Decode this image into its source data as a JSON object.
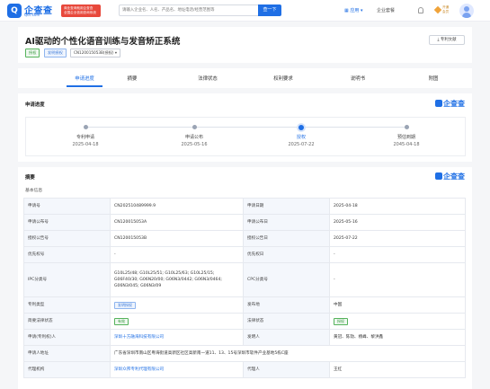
{
  "header": {
    "logo_letter": "Q",
    "logo_text": "企查查",
    "logo_sub": "Qcc.com",
    "promo_line1": "商业查询就用企查查",
    "promo_line2": "全国企业信用查询系统",
    "search_placeholder": "请输入企业名、人名、产品名、地址电话/经营范围等",
    "search_button": "查一下",
    "app_label": "应用",
    "enterprise_edition": "企业套餐",
    "vip_line1": "开通",
    "vip_line2": "会员"
  },
  "title_section": {
    "title": "AI驱动的个性化语音训练与发音矫正系统",
    "tags": [
      "授权",
      "发明授权"
    ],
    "patent_number_tag": "CN120015053B(授权)",
    "patent_file_button": "专利文献"
  },
  "tabs": [
    "申请进度",
    "摘要",
    "法律状态",
    "权利要求",
    "说明书",
    "附图"
  ],
  "progress": {
    "section_title": "申请进度",
    "brand": "企查查",
    "steps": [
      {
        "label": "专利申请",
        "date": "2025-04-18"
      },
      {
        "label": "申请公布",
        "date": "2025-05-16"
      },
      {
        "label": "授权",
        "date": "2025-07-22"
      },
      {
        "label": "预估到期",
        "date": "2045-04-18"
      }
    ],
    "active_step": 2
  },
  "abstract": {
    "section_title": "摘要",
    "brand": "企查查",
    "basic_info_title": "基本信息"
  },
  "info_table": {
    "r1": {
      "k1": "申请号",
      "v1": "CN202510489999.9",
      "k2": "申请日期",
      "v2": "2025-04-18"
    },
    "r2": {
      "k1": "申请公布号",
      "v1": "CN120015053A",
      "k2": "申请公布日",
      "v2": "2025-05-16"
    },
    "r3": {
      "k1": "授权公告号",
      "v1": "CN120015053B",
      "k2": "授权公告日",
      "v2": "2025-07-22"
    },
    "r4": {
      "k1": "优先权号",
      "v1": "-",
      "k2": "优先权日",
      "v2": "-"
    },
    "r5": {
      "k1": "IPC分类号",
      "v1": "G10L25/48; G10L25/51; G10L25/63; G10L25/15; G06F40/30; G06N20/00; G06N3/0442; G06N3/0464; G06N3/045; G06N3/09",
      "k2": "CPC分类号",
      "v2": "-"
    },
    "r6": {
      "k1": "专利类型",
      "v1": "发明授权",
      "k2": "发布地",
      "v2": "中国"
    },
    "r7": {
      "k1": "简要法律状态",
      "v1": "有效",
      "k2": "法律状态",
      "v2": "授权"
    },
    "r8": {
      "k1": "申请(专利权)人",
      "v1": "深圳十方融海科技有限公司",
      "k2": "发明人",
      "v2": "黄冠、陈劼、杨峰、黎洪鑫"
    },
    "r9": {
      "k1": "申请人地址",
      "v1": "广东省深圳市南山区粤海街道高新区社区高新南一道11、13、15号深圳市软件产业基地5栋C座"
    },
    "r10": {
      "k1": "代理机构",
      "v1": "深圳众邦专利代理有限公司",
      "k2": "代理人",
      "v2": "王红"
    }
  },
  "colors": {
    "accent": "#1f6fe5",
    "green": "#3a9a42",
    "promo": "#e8483b"
  }
}
